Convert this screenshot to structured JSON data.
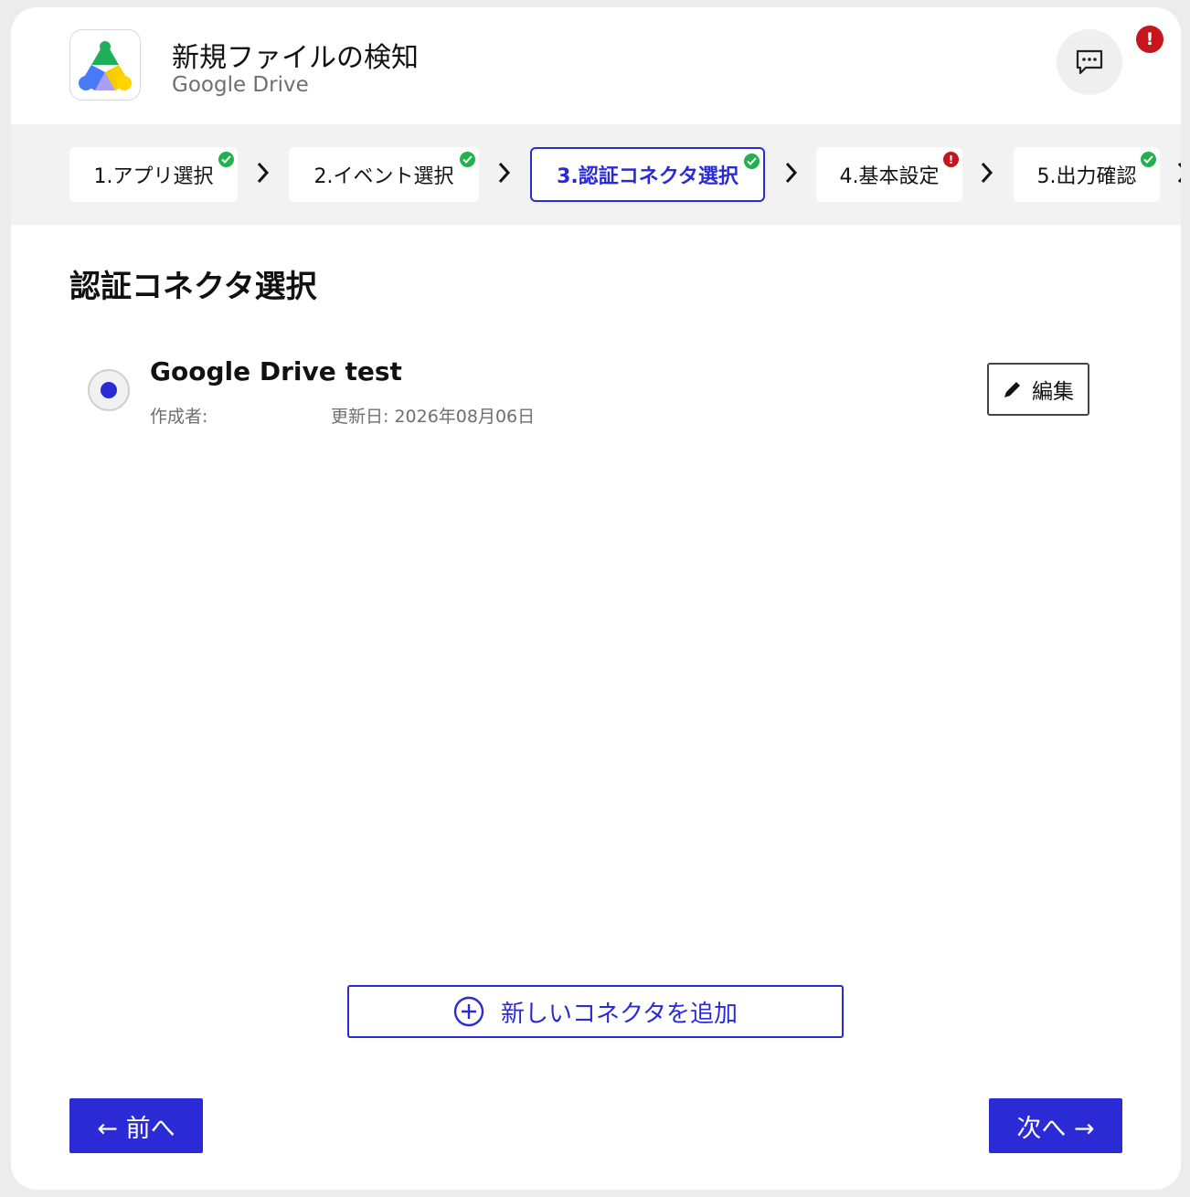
{
  "header": {
    "title": "新規ファイルの検知",
    "subtitle": "Google Drive",
    "alert_mark": "!"
  },
  "steps": [
    {
      "label": "1.アプリ選択",
      "status": "ok"
    },
    {
      "label": "2.イベント選択",
      "status": "ok"
    },
    {
      "label": "3.認証コネクタ選択",
      "status": "ok",
      "active": true
    },
    {
      "label": "4.基本設定",
      "status": "error",
      "mark": "!"
    },
    {
      "label": "5.出力確認",
      "status": "ok"
    }
  ],
  "section": {
    "title": "認証コネクタ選択"
  },
  "connector": {
    "name": "Google Drive test",
    "creator_label": "作成者:",
    "updated_label": "更新日: 2026年08月06日",
    "selected": true,
    "edit_label": "編集"
  },
  "add_connector_label": "新しいコネクタを追加",
  "nav": {
    "prev_label": "← 前へ",
    "next_label": "次へ →"
  },
  "colors": {
    "accent": "#2b2bd6",
    "success": "#23b14d",
    "error": "#c4161c"
  }
}
